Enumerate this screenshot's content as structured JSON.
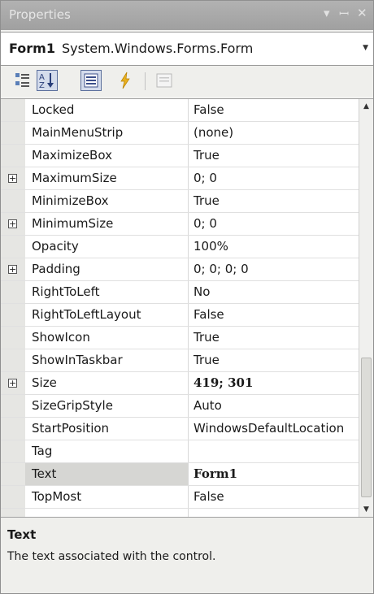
{
  "window": {
    "title": "Properties"
  },
  "selector": {
    "object_name": "Form1",
    "object_type": "System.Windows.Forms.Form"
  },
  "toolbar": {
    "buttons": [
      {
        "name": "categorized-icon",
        "selected": false
      },
      {
        "name": "alphabetical-icon",
        "label": "A↓Z",
        "selected": true
      },
      {
        "name": "properties-icon",
        "selected": true
      },
      {
        "name": "events-icon",
        "selected": false
      },
      {
        "name": "property-pages-icon",
        "selected": false
      }
    ]
  },
  "properties": [
    {
      "name": "Locked",
      "value": "False",
      "expandable": false,
      "bold": false
    },
    {
      "name": "MainMenuStrip",
      "value": "(none)",
      "expandable": false,
      "bold": false
    },
    {
      "name": "MaximizeBox",
      "value": "True",
      "expandable": false,
      "bold": false
    },
    {
      "name": "MaximumSize",
      "value": "0; 0",
      "expandable": true,
      "bold": false
    },
    {
      "name": "MinimizeBox",
      "value": "True",
      "expandable": false,
      "bold": false
    },
    {
      "name": "MinimumSize",
      "value": "0; 0",
      "expandable": true,
      "bold": false
    },
    {
      "name": "Opacity",
      "value": "100%",
      "expandable": false,
      "bold": false
    },
    {
      "name": "Padding",
      "value": "0; 0; 0; 0",
      "expandable": true,
      "bold": false
    },
    {
      "name": "RightToLeft",
      "value": "No",
      "expandable": false,
      "bold": false
    },
    {
      "name": "RightToLeftLayout",
      "value": "False",
      "expandable": false,
      "bold": false
    },
    {
      "name": "ShowIcon",
      "value": "True",
      "expandable": false,
      "bold": false
    },
    {
      "name": "ShowInTaskbar",
      "value": "True",
      "expandable": false,
      "bold": false
    },
    {
      "name": "Size",
      "value": "419; 301",
      "expandable": true,
      "bold": true
    },
    {
      "name": "SizeGripStyle",
      "value": "Auto",
      "expandable": false,
      "bold": false
    },
    {
      "name": "StartPosition",
      "value": "WindowsDefaultLocation",
      "expandable": false,
      "bold": false
    },
    {
      "name": "Tag",
      "value": "",
      "expandable": false,
      "bold": false
    },
    {
      "name": "Text",
      "value": "Form1",
      "expandable": false,
      "bold": true,
      "selected": true
    },
    {
      "name": "TopMost",
      "value": "False",
      "expandable": false,
      "bold": false
    }
  ],
  "description": {
    "title": "Text",
    "text": "The text associated with the control."
  },
  "colors": {
    "title_bar": "#a8a8a8",
    "selected_row": "#d6d6d3",
    "gutter": "#e6e6e3",
    "toolbar_selected": "#d4dcec"
  }
}
